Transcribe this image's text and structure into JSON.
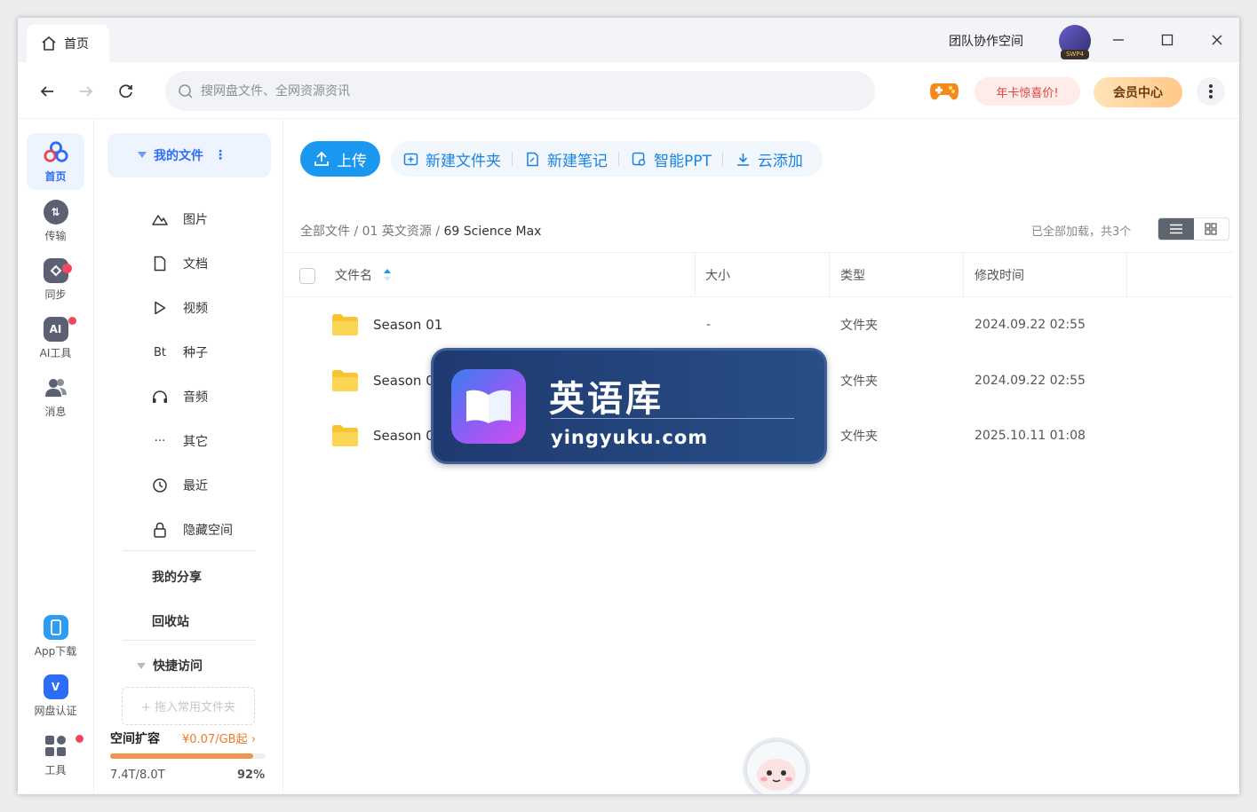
{
  "tabs": {
    "home": "首页"
  },
  "titlebar": {
    "team": "团队协作空间",
    "avatar_tag": "SWP4"
  },
  "search": {
    "placeholder": "搜网盘文件、全网资源资讯"
  },
  "header": {
    "promo": "年卡惊喜价!",
    "vip": "会员中心"
  },
  "rail": {
    "home": "首页",
    "transfer": "传输",
    "sync": "同步",
    "ai": "AI工具",
    "ai_badge": "AI",
    "transfer_badge": "⇅",
    "messages": "消息",
    "app": "App下载",
    "verify": "网盘认证",
    "verify_badge": "V",
    "tools": "工具"
  },
  "sidebar": {
    "my_files": "我的文件",
    "items": [
      {
        "label": "图片",
        "icon": "image-icon"
      },
      {
        "label": "文档",
        "icon": "document-icon"
      },
      {
        "label": "视频",
        "icon": "video-icon"
      },
      {
        "label": "种子",
        "icon": "bt-icon",
        "glyph": "Bt"
      },
      {
        "label": "音频",
        "icon": "headphones-icon"
      },
      {
        "label": "其它",
        "icon": "more-icon",
        "glyph": "···"
      },
      {
        "label": "最近",
        "icon": "clock-icon"
      },
      {
        "label": "隐藏空间",
        "icon": "lock-icon"
      }
    ],
    "share": "我的分享",
    "trash": "回收站",
    "quick_access": "快捷访问",
    "drop_hint": "+ 拖入常用文件夹",
    "storage": {
      "title": "空间扩容",
      "price": "¥0.07/GB起 ›",
      "used": "7.4T/8.0T",
      "percent": "92%",
      "fraction": 0.92
    }
  },
  "toolbar": {
    "upload": "上传",
    "new_folder": "新建文件夹",
    "new_note": "新建笔记",
    "smart_ppt": "智能PPT",
    "cloud_add": "云添加"
  },
  "breadcrumb": {
    "root": "全部文件",
    "sep1": " / ",
    "level1": "01 英文资源",
    "sep2": " / ",
    "current": "69 Science Max"
  },
  "status": {
    "loaded": "已全部加载，共3个"
  },
  "table": {
    "headers": {
      "name": "文件名",
      "size": "大小",
      "type": "类型",
      "modified": "修改时间"
    },
    "rows": [
      {
        "name": "Season 01",
        "size": "-",
        "type": "文件夹",
        "modified": "2024.09.22 02:55"
      },
      {
        "name": "Season 02",
        "size": "-",
        "type": "文件夹",
        "modified": "2024.09.22 02:55"
      },
      {
        "name": "Season 03",
        "size": "-",
        "type": "文件夹",
        "modified": "2025.10.11 01:08"
      }
    ]
  },
  "watermark": {
    "title": "英语库",
    "url": "yingyuku.com"
  },
  "colors": {
    "accent": "#2d6cf6",
    "upload": "#1a98ef",
    "promo_text": "#e0453a",
    "storage_bar": "#ef9351",
    "folder": "#f7c531"
  }
}
